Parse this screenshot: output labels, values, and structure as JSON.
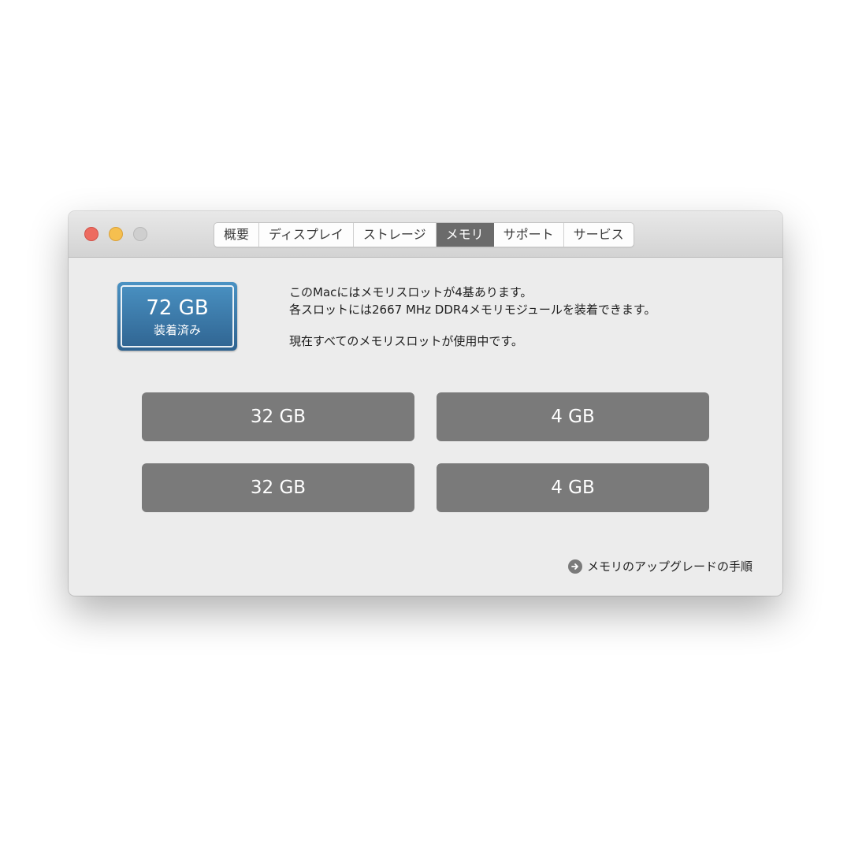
{
  "tabs": [
    {
      "label": "概要"
    },
    {
      "label": "ディスプレイ"
    },
    {
      "label": "ストレージ"
    },
    {
      "label": "メモリ",
      "active": true
    },
    {
      "label": "サポート"
    },
    {
      "label": "サービス"
    }
  ],
  "installed": {
    "size": "72 GB",
    "label": "装着済み"
  },
  "info": {
    "line1": "このMacにはメモリスロットが4基あります。",
    "line2": "各スロットには2667 MHz DDR4メモリモジュールを装着できます。",
    "line3": "現在すべてのメモリスロットが使用中です。"
  },
  "slots": [
    {
      "size": "32 GB"
    },
    {
      "size": "4 GB"
    },
    {
      "size": "32 GB"
    },
    {
      "size": "4 GB"
    }
  ],
  "upgrade_link": {
    "label": "メモリのアップグレードの手順",
    "icon": "arrow-right-circle-icon"
  },
  "colors": {
    "close": "#ed6b60",
    "minimize": "#f5bf4f",
    "zoom": "#cfcfcf",
    "installed_box": "#3a78a8",
    "slot": "#7a7a7a",
    "active_tab": "#6b6b6b"
  }
}
